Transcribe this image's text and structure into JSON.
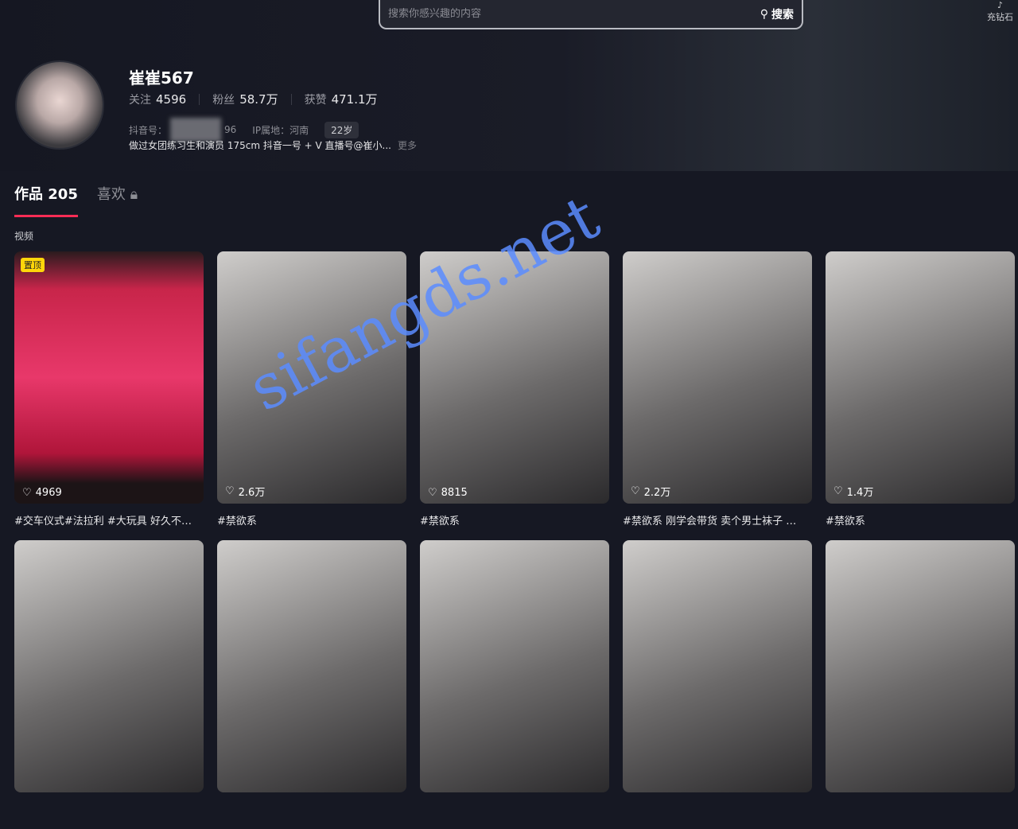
{
  "search": {
    "placeholder": "搜索你感兴趣的内容",
    "button": "搜索"
  },
  "header": {
    "recharge": "充钻石"
  },
  "profile": {
    "name": "崔崔567",
    "following_label": "关注",
    "following": "4596",
    "followers_label": "粉丝",
    "followers": "58.7万",
    "likes_label": "获赞",
    "likes": "471.1万",
    "id_label": "抖音号：",
    "id_suffix": "96",
    "ip": "IP属地：河南",
    "age": "22岁",
    "bio": "做过女团练习生和演员 175cm 抖音一号 + V 直播号@崔小...",
    "more": "更多"
  },
  "tabs": [
    {
      "label": "作品 205"
    },
    {
      "label": "喜欢"
    }
  ],
  "section": "视频",
  "pinned_label": "置顶",
  "videos": [
    {
      "likes": "4969",
      "caption": "#交车仪式#法拉利 #大玩具 好久不…"
    },
    {
      "likes": "2.6万",
      "caption": "#禁欲系"
    },
    {
      "likes": "8815",
      "caption": "#禁欲系"
    },
    {
      "likes": "2.2万",
      "caption": "#禁欲系 刚学会带货 卖个男士袜子 …"
    },
    {
      "likes": "1.4万",
      "caption": "#禁欲系"
    },
    {
      "likes": "",
      "caption": ""
    },
    {
      "likes": "",
      "caption": ""
    },
    {
      "likes": "",
      "caption": ""
    },
    {
      "likes": "",
      "caption": ""
    },
    {
      "likes": "",
      "caption": ""
    }
  ],
  "watermark": "sifangds.net"
}
